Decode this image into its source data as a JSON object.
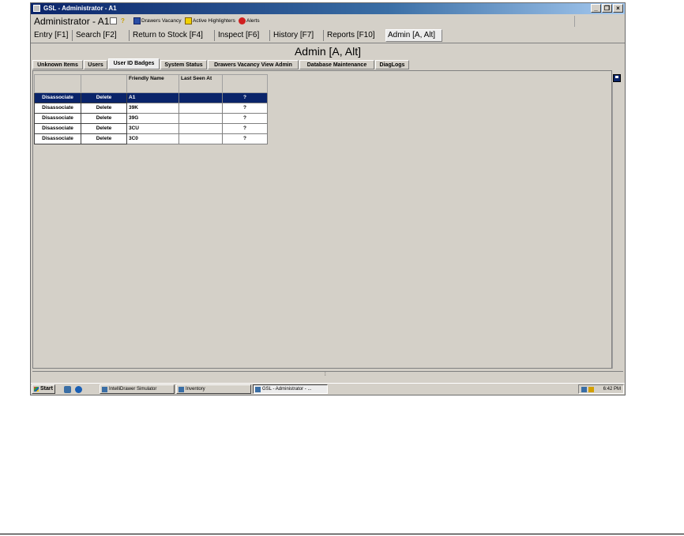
{
  "window": {
    "title": "GSL - Administrator - A1",
    "controls": [
      "_",
      "❐",
      "×"
    ]
  },
  "userbar": {
    "user": "Administrator - A1",
    "drawers_vacancy": "Drawers Vacancy",
    "active_highlighters": "Active Highlighters",
    "alerts": "Alerts"
  },
  "main_tabs": [
    {
      "label": "Entry [F1]"
    },
    {
      "label": "Search [F2]"
    },
    {
      "label": "Return to Stock [F4]"
    },
    {
      "label": "Inspect [F6]"
    },
    {
      "label": "History [F7]"
    },
    {
      "label": "Reports [F10]"
    },
    {
      "label": "Admin [A, Alt]"
    }
  ],
  "heading": "Admin [A, Alt]",
  "sub_tabs": [
    {
      "label": "Unknown Items"
    },
    {
      "label": "Users"
    },
    {
      "label": "User ID Badges"
    },
    {
      "label": "System Status"
    },
    {
      "label": "Drawers Vacancy View Admin"
    },
    {
      "label": "Database Maintenance"
    },
    {
      "label": "DiagLogs"
    }
  ],
  "grid": {
    "headers": [
      "",
      "",
      "Friendly Name",
      "Last Seen At",
      ""
    ],
    "rows": [
      {
        "disassociate": "Disassociate",
        "delete": "Delete",
        "name": "A1",
        "last_seen": "",
        "q": "?"
      },
      {
        "disassociate": "Disassociate",
        "delete": "Delete",
        "name": "39K",
        "last_seen": "",
        "q": "?"
      },
      {
        "disassociate": "Disassociate",
        "delete": "Delete",
        "name": "39G",
        "last_seen": "",
        "q": "?"
      },
      {
        "disassociate": "Disassociate",
        "delete": "Delete",
        "name": "3CU",
        "last_seen": "",
        "q": "?"
      },
      {
        "disassociate": "Disassociate",
        "delete": "Delete",
        "name": "3C0",
        "last_seen": "",
        "q": "?"
      }
    ]
  },
  "taskbar": {
    "start": "Start",
    "items": [
      {
        "label": "IntelliDrawer Simulator"
      },
      {
        "label": "Inventory"
      },
      {
        "label": "GSL - Administrator - ..."
      }
    ],
    "clock": "6:42 PM"
  },
  "colors": {
    "selection": "#0a246a",
    "face": "#d4d0c8"
  }
}
